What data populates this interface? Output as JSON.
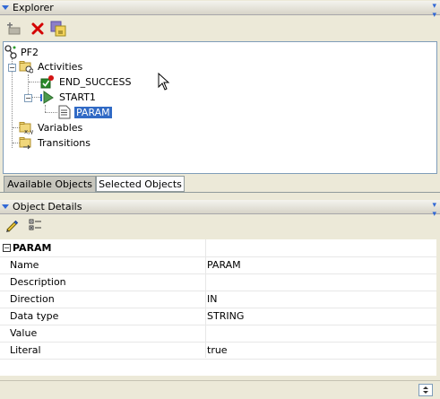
{
  "explorer": {
    "title": "Explorer",
    "toolbar": [
      {
        "name": "add-icon"
      },
      {
        "name": "delete-icon"
      },
      {
        "name": "properties-icon"
      }
    ],
    "tree": {
      "root": "PF2",
      "activities": "Activities",
      "end_success": "END_SUCCESS",
      "start1": "START1",
      "param": "PARAM",
      "variables": "Variables",
      "transitions": "Transitions"
    },
    "tabs": [
      "Available Objects",
      "Selected Objects"
    ]
  },
  "details": {
    "title": "Object Details",
    "section": "PARAM",
    "properties": [
      {
        "key": "Name",
        "value": "PARAM"
      },
      {
        "key": "Description",
        "value": ""
      },
      {
        "key": "Direction",
        "value": "IN"
      },
      {
        "key": "Data type",
        "value": "STRING"
      },
      {
        "key": "Value",
        "value": ""
      },
      {
        "key": "Literal",
        "value": "true"
      }
    ]
  },
  "colors": {
    "accent": "#3168d5",
    "selection": "#316ac5",
    "panel_bg": "#ece9d8"
  }
}
